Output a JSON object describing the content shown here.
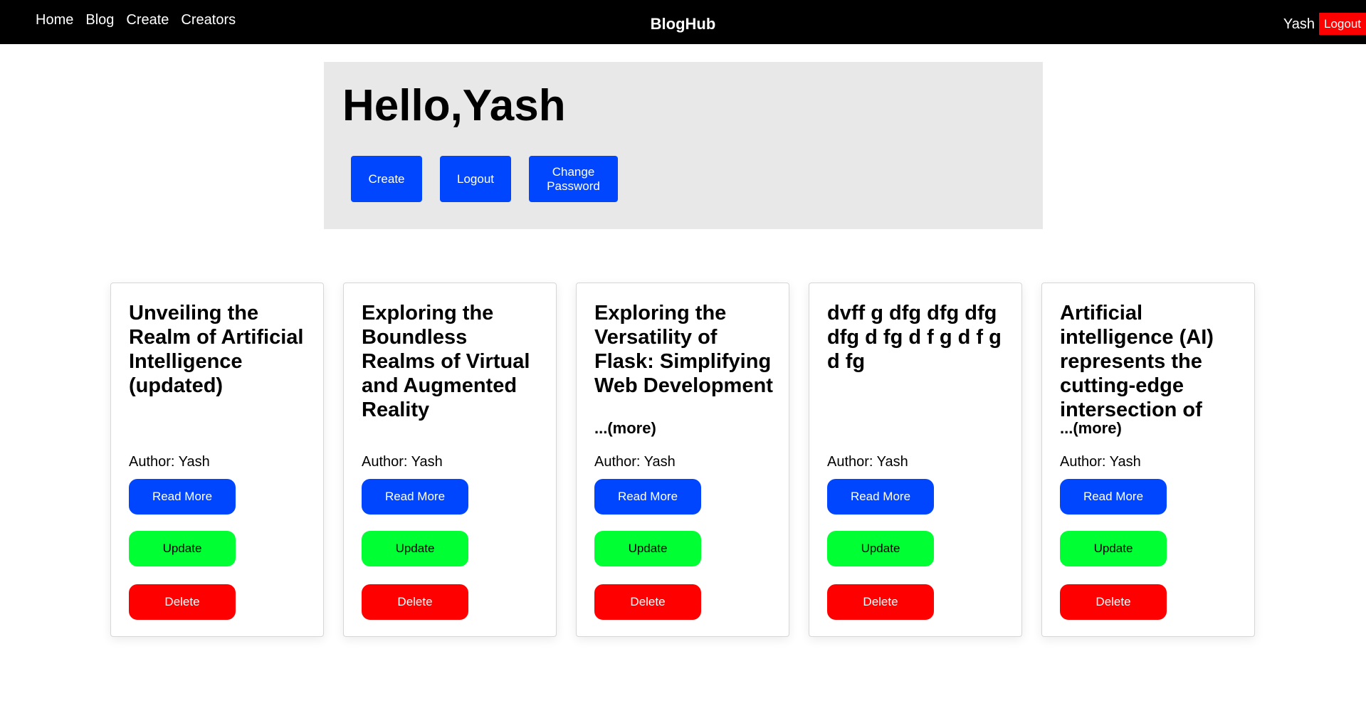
{
  "nav": {
    "links": [
      "Home",
      "Blog",
      "Create",
      "Creators"
    ],
    "brand": "BlogHub",
    "username": "Yash",
    "logout_label": "Logout"
  },
  "hero": {
    "greeting": "Hello,Yash",
    "buttons": [
      "Create",
      "Logout",
      "Change Password"
    ]
  },
  "posts": [
    {
      "title": "Unveiling the Realm of Artificial Intelligence (updated)",
      "more": "",
      "author": "Author: Yash",
      "read_more": "Read More",
      "update": "Update",
      "delete": "Delete"
    },
    {
      "title": "Exploring the Boundless Realms of Virtual and Augmented Reality",
      "more": "",
      "author": "Author: Yash",
      "read_more": "Read More",
      "update": "Update",
      "delete": "Delete"
    },
    {
      "title": "Exploring the Versatility of Flask: Simplifying Web Development",
      "more": "...(more)",
      "author": "Author: Yash",
      "read_more": "Read More",
      "update": "Update",
      "delete": "Delete"
    },
    {
      "title": "dvff g dfg dfg dfg dfg d fg d f g d f g d fg",
      "more": "",
      "author": "Author: Yash",
      "read_more": "Read More",
      "update": "Update",
      "delete": "Delete"
    },
    {
      "title": "Artificial intelligence (AI) represents the cutting-edge intersection of",
      "more": "...(more)",
      "author": "Author: Yash",
      "read_more": "Read More",
      "update": "Update",
      "delete": "Delete"
    }
  ],
  "colors": {
    "navbar": "#000000",
    "primary": "#0046ff",
    "success": "#00ff33",
    "danger": "#ff0000",
    "hero_bg": "#e8e8e8"
  }
}
